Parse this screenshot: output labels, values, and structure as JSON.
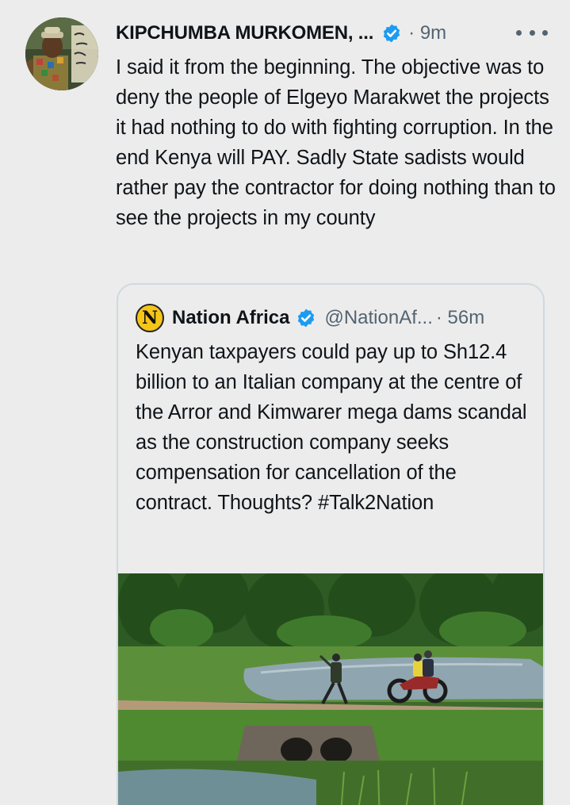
{
  "tweet": {
    "author_name": "KIPCHUMBA MURKOMEN, ...",
    "timestamp": "· 9m",
    "text": "I said it from the beginning. The objective was to deny the people of Elgeyo Marakwet the projects it had nothing to do with fighting corruption. In the end Kenya will PAY. Sadly State sadists would rather pay the contractor for doing nothing than to see the projects in my county"
  },
  "quoted_tweet": {
    "avatar_letter": "N",
    "author_name": "Nation Africa",
    "handle": "@NationAf...",
    "timestamp": "· 56m",
    "text": "Kenyan taxpayers could pay up to Sh12.4 billion to an Italian company at the centre of the Arror and Kimwarer mega dams scandal as the construction company seeks compensation for cancellation of the contract. Thoughts? #Talk2Nation"
  },
  "colors": {
    "background": "#ececec",
    "text": "#0f1419",
    "secondary_text": "#536471",
    "verified_blue": "#1d9bf0",
    "avatar_yellow": "#f5c518",
    "border": "#cfd9de"
  },
  "icons": [
    "verified-badge-icon",
    "more-options-icon"
  ]
}
